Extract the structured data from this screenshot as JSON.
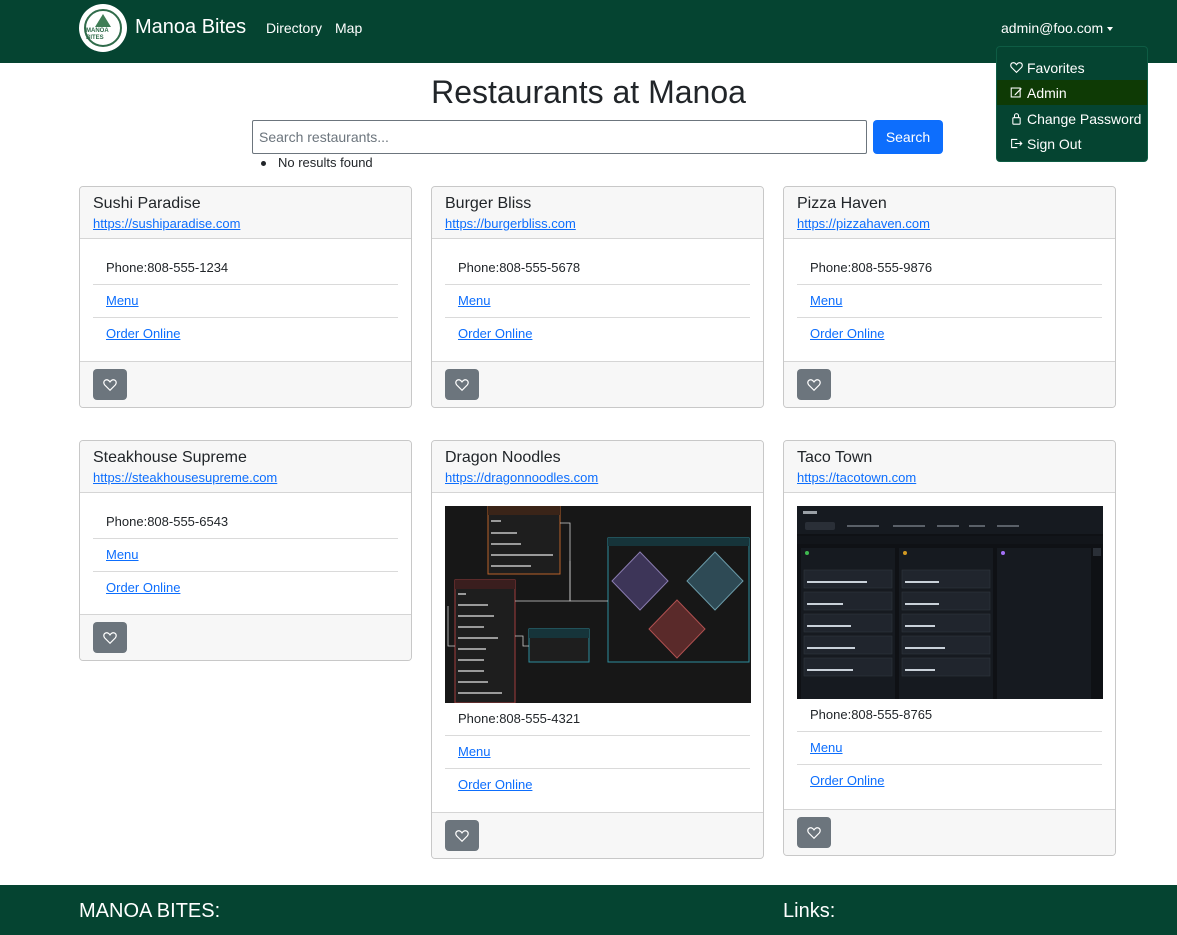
{
  "navbar": {
    "logo_text": "MANOA BITES",
    "brand": "Manoa Bites",
    "links": [
      "Directory",
      "Map"
    ],
    "user": "admin@foo.com",
    "bg_color": "#054431"
  },
  "user_menu": {
    "items": [
      {
        "label": "Favorites",
        "icon": "heart-icon"
      },
      {
        "label": "Admin",
        "icon": "pencil-square-icon",
        "active": true
      },
      {
        "label": "Change Password",
        "icon": "lock-icon"
      },
      {
        "label": "Sign Out",
        "icon": "box-arrow-right-icon"
      }
    ]
  },
  "page": {
    "title": "Restaurants at Manoa",
    "search_placeholder": "Search restaurants...",
    "search_value": "",
    "search_button": "Search",
    "results_message": "No results found"
  },
  "restaurants": [
    {
      "name": "Sushi Paradise",
      "url": "https://sushiparadise.com",
      "phone_label": "Phone:",
      "phone": "808-555-1234",
      "menu": "Menu",
      "order": "Order Online",
      "image": null
    },
    {
      "name": "Burger Bliss",
      "url": "https://burgerbliss.com",
      "phone_label": "Phone:",
      "phone": "808-555-5678",
      "menu": "Menu",
      "order": "Order Online",
      "image": null
    },
    {
      "name": "Pizza Haven",
      "url": "https://pizzahaven.com",
      "phone_label": "Phone:",
      "phone": "808-555-9876",
      "menu": "Menu",
      "order": "Order Online",
      "image": null
    },
    {
      "name": "Steakhouse Supreme",
      "url": "https://steakhousesupreme.com",
      "phone_label": "Phone:",
      "phone": "808-555-6543",
      "menu": "Menu",
      "order": "Order Online",
      "image": null
    },
    {
      "name": "Dragon Noodles",
      "url": "https://dragonnoodles.com",
      "phone_label": "Phone:",
      "phone": "808-555-4321",
      "menu": "Menu",
      "order": "Order Online",
      "image": "diagram-screenshot"
    },
    {
      "name": "Taco Town",
      "url": "https://tacotown.com",
      "phone_label": "Phone:",
      "phone": "808-555-8765",
      "menu": "Menu",
      "order": "Order Online",
      "image": "kanban-board-screenshot"
    }
  ],
  "footer": {
    "brand_heading": "MANOA BITES:",
    "links_heading": "Links:"
  }
}
